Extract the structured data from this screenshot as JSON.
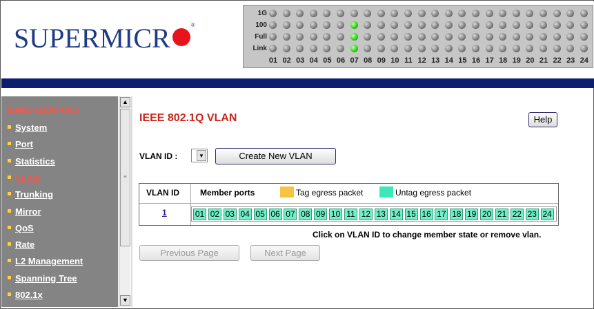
{
  "header": {
    "logo_text": "SUPERMICR",
    "led_panel": {
      "row_labels": [
        "1G",
        "100",
        "Full",
        "Link"
      ],
      "port_numbers": [
        "01",
        "02",
        "03",
        "04",
        "05",
        "06",
        "07",
        "08",
        "09",
        "10",
        "11",
        "12",
        "13",
        "14",
        "15",
        "16",
        "17",
        "18",
        "19",
        "20",
        "21",
        "22",
        "23",
        "24"
      ],
      "active_leds": [
        {
          "row": "100",
          "port": "07"
        },
        {
          "row": "Full",
          "port": "07"
        },
        {
          "row": "Link",
          "port": "07"
        }
      ]
    }
  },
  "sidebar": {
    "system_name": "BMB-GEM-003",
    "items": [
      {
        "label": "System",
        "active": false
      },
      {
        "label": "Port",
        "active": false
      },
      {
        "label": "Statistics",
        "active": false
      },
      {
        "label": "VLAN",
        "active": true
      },
      {
        "label": "Trunking",
        "active": false
      },
      {
        "label": "Mirror",
        "active": false
      },
      {
        "label": "QoS",
        "active": false
      },
      {
        "label": "Rate",
        "active": false
      },
      {
        "label": "L2 Management",
        "active": false
      },
      {
        "label": "Spanning Tree",
        "active": false
      },
      {
        "label": "802.1x",
        "active": false
      }
    ]
  },
  "main": {
    "title": "IEEE 802.1Q VLAN",
    "help_label": "Help",
    "vlan_id_label": "VLAN ID :",
    "vlan_id_value": "",
    "create_label": "Create New VLAN",
    "table": {
      "col_vlan_id": "VLAN ID",
      "col_member_ports": "Member ports",
      "legend_tag": "Tag egress packet",
      "legend_untag": "Untag egress packet",
      "rows": [
        {
          "vlan_id": "1",
          "ports": [
            "01",
            "02",
            "03",
            "04",
            "05",
            "06",
            "07",
            "08",
            "09",
            "10",
            "11",
            "12",
            "13",
            "14",
            "15",
            "16",
            "17",
            "18",
            "19",
            "20",
            "21",
            "22",
            "23",
            "24"
          ]
        }
      ]
    },
    "hint": "Click on VLAN ID to change member state or remove vlan.",
    "prev_label": "Previous Page",
    "next_label": "Next Page"
  },
  "colors": {
    "brand_blue": "#1f3a86",
    "logo_dot": "#e8141b",
    "title_red": "#c8251b",
    "tag_color": "#f6c344",
    "untag_color": "#3be8b8",
    "sidebar_bg": "#848484",
    "header_bar": "#0b1f6f"
  }
}
